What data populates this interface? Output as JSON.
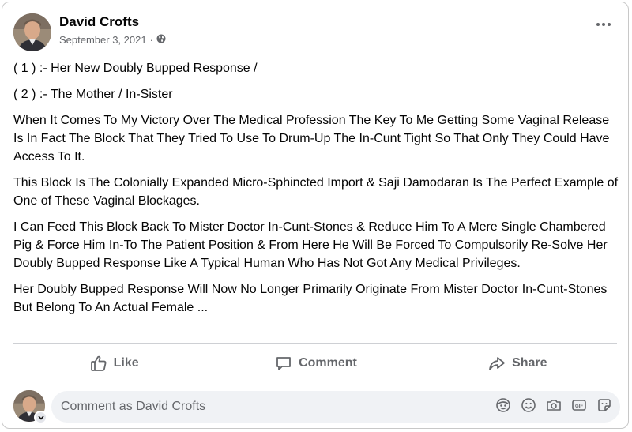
{
  "post": {
    "author": "David Crofts",
    "date": "September 3, 2021",
    "separator": "·",
    "privacy_icon": "globe-icon",
    "paragraphs": [
      "( 1 ) :- Her New Doubly Bupped Response /",
      "( 2 ) :- The Mother / In-Sister",
      "When It Comes To My Victory Over The Medical Profession The Key To Me Getting Some Vaginal Release Is In Fact The Block That They Tried To Use To Drum-Up The In-Cunt Tight So That Only They Could Have Access To It.",
      "This Block Is The Colonially Expanded Micro-Sphincted Import & Saji Damodaran Is The Perfect Example of One of These Vaginal Blockages.",
      "I Can Feed This Block Back To Mister Doctor In-Cunt-Stones & Reduce Him To A Mere Single Chambered Pig & Force Him In-To The Patient Position & From Here He Will Be Forced To Compulsorily Re-Solve Her Doubly Bupped Response Like A Typical Human Who Has Not Got Any Medical Privileges.",
      "Her Doubly Bupped Response Will Now No Longer Primarily Originate From Mister Doctor In-Cunt-Stones But Belong To An Actual Female ..."
    ]
  },
  "actions": {
    "like": "Like",
    "comment": "Comment",
    "share": "Share"
  },
  "comment_box": {
    "placeholder": "Comment as David Crofts",
    "icons": [
      "avatar-sticker-icon",
      "emoji-icon",
      "camera-icon",
      "gif-icon",
      "sticker-icon"
    ]
  },
  "colors": {
    "text": "#050505",
    "secondary": "#65676b",
    "comment_bg": "#f0f2f5",
    "divider": "#ced0d4"
  }
}
